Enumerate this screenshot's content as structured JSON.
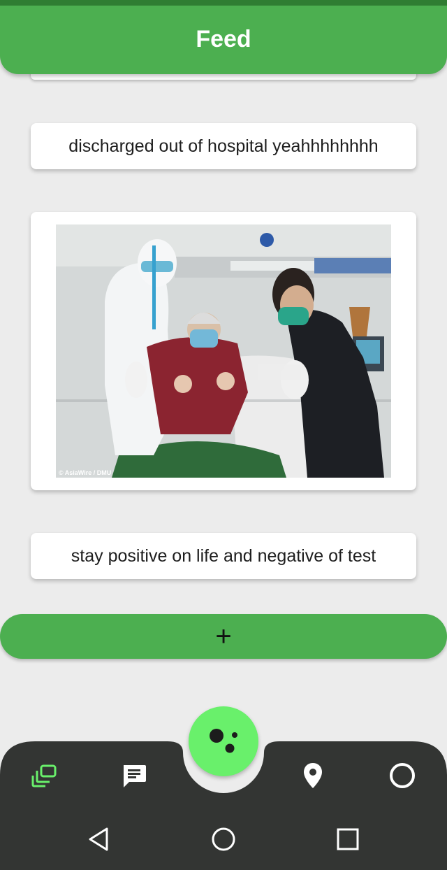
{
  "header": {
    "title": "Feed"
  },
  "posts": [
    {
      "type": "text",
      "text": "discharged out of hospital yeahhhhhhhh"
    },
    {
      "type": "image",
      "caption": "© AsiaWire / DMU",
      "image_icon": "hospital-patient-photo"
    },
    {
      "type": "text",
      "text": "stay positive on life and negative of test"
    }
  ],
  "add_button": {
    "label": "+"
  },
  "bottom_nav": {
    "items": [
      {
        "name": "feed",
        "icon": "stacked-cards-icon",
        "active": true
      },
      {
        "name": "chat",
        "icon": "chat-bubble-icon",
        "active": false
      },
      {
        "name": "map",
        "icon": "location-pin-icon",
        "active": false
      },
      {
        "name": "profile",
        "icon": "circle-icon",
        "active": false
      }
    ],
    "fab_icon": "assistant-dots-icon"
  },
  "system_nav": {
    "icons": [
      "back-triangle-icon",
      "home-circle-icon",
      "recents-square-icon"
    ]
  },
  "colors": {
    "primary": "#4caf50",
    "fab": "#69f06b",
    "bar": "#333533",
    "active_icon": "#69f06b"
  }
}
